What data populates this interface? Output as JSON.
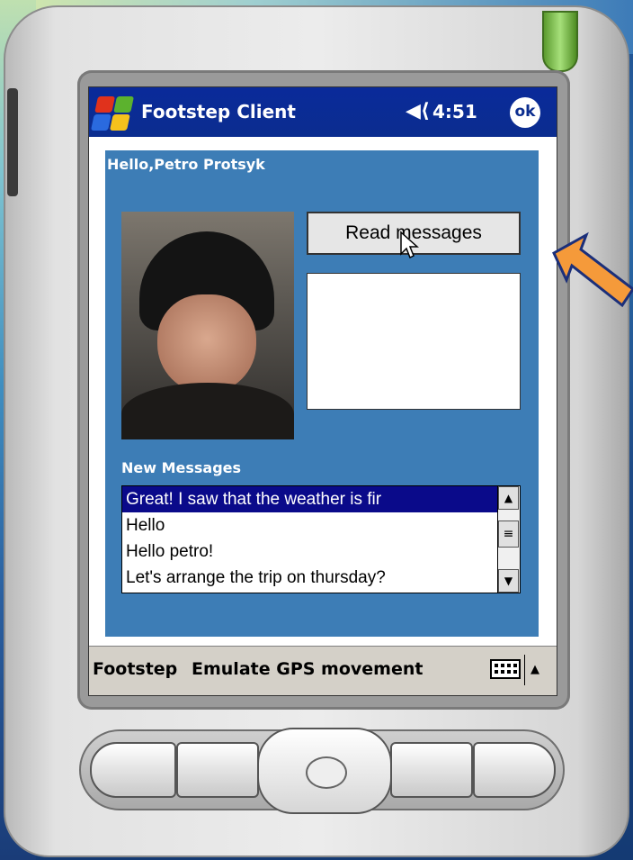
{
  "titlebar": {
    "app_title": "Footstep Client",
    "clock": "4:51",
    "ok_label": "ok",
    "speaker_icon": "speaker-icon",
    "start_icon": "windows-flag-icon"
  },
  "main": {
    "greeting": "Hello,Petro Protsyk",
    "read_button_label": "Read messages",
    "message_box_text": "",
    "new_messages_label": "New Messages",
    "messages": [
      "Great! I saw that the weather is fir",
      "Hello",
      "Hello petro!",
      "Let's arrange the trip on thursday?"
    ],
    "selected_message_index": 0
  },
  "menubar": {
    "left_menu": "Footstep",
    "right_menu": "Emulate GPS movement",
    "keyboard_icon": "keyboard-icon",
    "sip_arrow": "▲"
  },
  "colors": {
    "titlebar": "#0b2d8f",
    "panel": "#3d7db6",
    "selection": "#0a0a8a",
    "arrow": "#f59a3a"
  }
}
